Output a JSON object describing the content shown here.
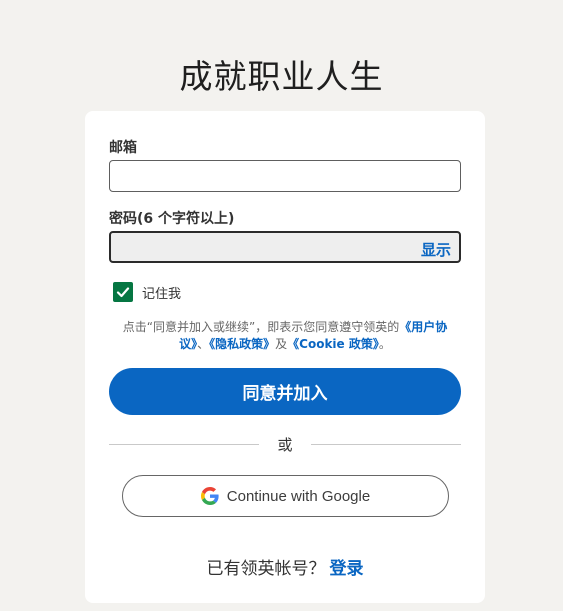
{
  "page": {
    "title": "成就职业人生"
  },
  "form": {
    "email_label": "邮箱",
    "email_value": "",
    "password_label": "密码(6 个字符以上)",
    "password_value": "",
    "show_label": "显示",
    "remember": {
      "label": "记住我",
      "checked": true
    },
    "terms": {
      "prefix": "点击“同意并加入或继续”，即表示您同意遵守领英的",
      "user_agreement": "《用户协议》",
      "sep": "、",
      "privacy_policy": "《隐私政策》",
      "and": "及",
      "cookie_policy": "《Cookie 政策》",
      "suffix": "。"
    },
    "submit_label": "同意并加入",
    "divider_text": "或",
    "google_label": "Continue with Google"
  },
  "footer": {
    "prompt": "已有领英帐号？",
    "signin_label": "登录"
  },
  "colors": {
    "accent": "#0a66c2",
    "checkbox": "#057642",
    "background": "#f3f2ef"
  },
  "icons": [
    "check-icon",
    "google-icon"
  ]
}
